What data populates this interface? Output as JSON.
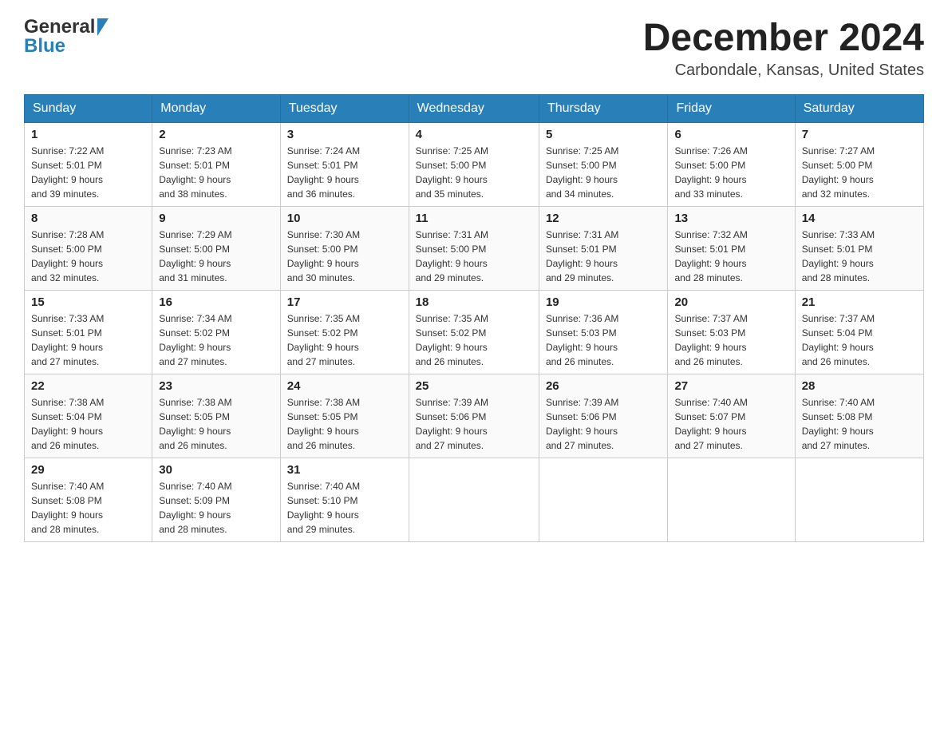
{
  "header": {
    "logo_general": "General",
    "logo_blue": "Blue",
    "month_title": "December 2024",
    "subtitle": "Carbondale, Kansas, United States"
  },
  "days_of_week": [
    "Sunday",
    "Monday",
    "Tuesday",
    "Wednesday",
    "Thursday",
    "Friday",
    "Saturday"
  ],
  "weeks": [
    [
      {
        "day": "1",
        "sunrise": "7:22 AM",
        "sunset": "5:01 PM",
        "daylight": "9 hours and 39 minutes."
      },
      {
        "day": "2",
        "sunrise": "7:23 AM",
        "sunset": "5:01 PM",
        "daylight": "9 hours and 38 minutes."
      },
      {
        "day": "3",
        "sunrise": "7:24 AM",
        "sunset": "5:01 PM",
        "daylight": "9 hours and 36 minutes."
      },
      {
        "day": "4",
        "sunrise": "7:25 AM",
        "sunset": "5:00 PM",
        "daylight": "9 hours and 35 minutes."
      },
      {
        "day": "5",
        "sunrise": "7:25 AM",
        "sunset": "5:00 PM",
        "daylight": "9 hours and 34 minutes."
      },
      {
        "day": "6",
        "sunrise": "7:26 AM",
        "sunset": "5:00 PM",
        "daylight": "9 hours and 33 minutes."
      },
      {
        "day": "7",
        "sunrise": "7:27 AM",
        "sunset": "5:00 PM",
        "daylight": "9 hours and 32 minutes."
      }
    ],
    [
      {
        "day": "8",
        "sunrise": "7:28 AM",
        "sunset": "5:00 PM",
        "daylight": "9 hours and 32 minutes."
      },
      {
        "day": "9",
        "sunrise": "7:29 AM",
        "sunset": "5:00 PM",
        "daylight": "9 hours and 31 minutes."
      },
      {
        "day": "10",
        "sunrise": "7:30 AM",
        "sunset": "5:00 PM",
        "daylight": "9 hours and 30 minutes."
      },
      {
        "day": "11",
        "sunrise": "7:31 AM",
        "sunset": "5:00 PM",
        "daylight": "9 hours and 29 minutes."
      },
      {
        "day": "12",
        "sunrise": "7:31 AM",
        "sunset": "5:01 PM",
        "daylight": "9 hours and 29 minutes."
      },
      {
        "day": "13",
        "sunrise": "7:32 AM",
        "sunset": "5:01 PM",
        "daylight": "9 hours and 28 minutes."
      },
      {
        "day": "14",
        "sunrise": "7:33 AM",
        "sunset": "5:01 PM",
        "daylight": "9 hours and 28 minutes."
      }
    ],
    [
      {
        "day": "15",
        "sunrise": "7:33 AM",
        "sunset": "5:01 PM",
        "daylight": "9 hours and 27 minutes."
      },
      {
        "day": "16",
        "sunrise": "7:34 AM",
        "sunset": "5:02 PM",
        "daylight": "9 hours and 27 minutes."
      },
      {
        "day": "17",
        "sunrise": "7:35 AM",
        "sunset": "5:02 PM",
        "daylight": "9 hours and 27 minutes."
      },
      {
        "day": "18",
        "sunrise": "7:35 AM",
        "sunset": "5:02 PM",
        "daylight": "9 hours and 26 minutes."
      },
      {
        "day": "19",
        "sunrise": "7:36 AM",
        "sunset": "5:03 PM",
        "daylight": "9 hours and 26 minutes."
      },
      {
        "day": "20",
        "sunrise": "7:37 AM",
        "sunset": "5:03 PM",
        "daylight": "9 hours and 26 minutes."
      },
      {
        "day": "21",
        "sunrise": "7:37 AM",
        "sunset": "5:04 PM",
        "daylight": "9 hours and 26 minutes."
      }
    ],
    [
      {
        "day": "22",
        "sunrise": "7:38 AM",
        "sunset": "5:04 PM",
        "daylight": "9 hours and 26 minutes."
      },
      {
        "day": "23",
        "sunrise": "7:38 AM",
        "sunset": "5:05 PM",
        "daylight": "9 hours and 26 minutes."
      },
      {
        "day": "24",
        "sunrise": "7:38 AM",
        "sunset": "5:05 PM",
        "daylight": "9 hours and 26 minutes."
      },
      {
        "day": "25",
        "sunrise": "7:39 AM",
        "sunset": "5:06 PM",
        "daylight": "9 hours and 27 minutes."
      },
      {
        "day": "26",
        "sunrise": "7:39 AM",
        "sunset": "5:06 PM",
        "daylight": "9 hours and 27 minutes."
      },
      {
        "day": "27",
        "sunrise": "7:40 AM",
        "sunset": "5:07 PM",
        "daylight": "9 hours and 27 minutes."
      },
      {
        "day": "28",
        "sunrise": "7:40 AM",
        "sunset": "5:08 PM",
        "daylight": "9 hours and 27 minutes."
      }
    ],
    [
      {
        "day": "29",
        "sunrise": "7:40 AM",
        "sunset": "5:08 PM",
        "daylight": "9 hours and 28 minutes."
      },
      {
        "day": "30",
        "sunrise": "7:40 AM",
        "sunset": "5:09 PM",
        "daylight": "9 hours and 28 minutes."
      },
      {
        "day": "31",
        "sunrise": "7:40 AM",
        "sunset": "5:10 PM",
        "daylight": "9 hours and 29 minutes."
      },
      null,
      null,
      null,
      null
    ]
  ],
  "labels": {
    "sunrise": "Sunrise:",
    "sunset": "Sunset:",
    "daylight": "Daylight:"
  }
}
